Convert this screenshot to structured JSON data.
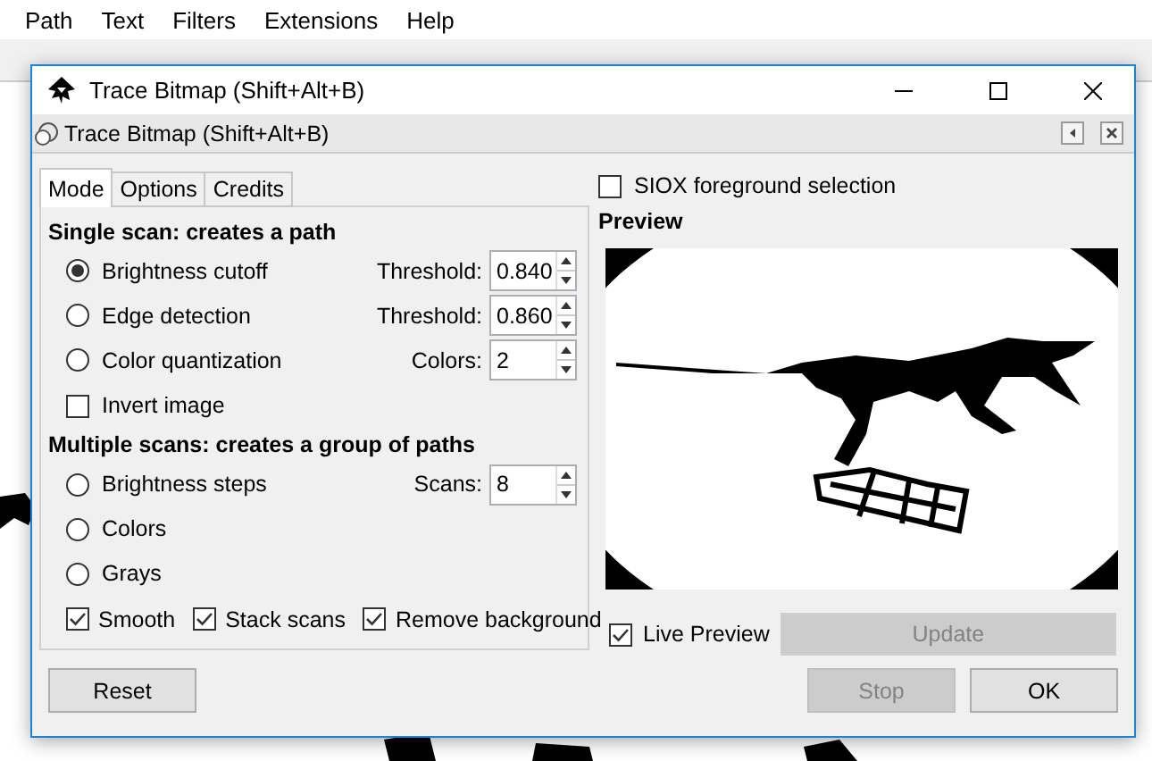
{
  "menu": [
    {
      "label": "Path"
    },
    {
      "label": "Text"
    },
    {
      "label": "Filters"
    },
    {
      "label": "Extensions"
    },
    {
      "label": "Help"
    }
  ],
  "dialog": {
    "title": "Trace Bitmap (Shift+Alt+B)",
    "panel_title": "Trace Bitmap (Shift+Alt+B)",
    "tabs": [
      {
        "label": "Mode",
        "selected": true
      },
      {
        "label": "Options",
        "selected": false
      },
      {
        "label": "Credits",
        "selected": false
      }
    ],
    "single_scan": {
      "heading": "Single scan: creates a path",
      "options": [
        {
          "label": "Brightness cutoff",
          "selected": true,
          "field_label": "Threshold:",
          "value": "0.840"
        },
        {
          "label": "Edge detection",
          "selected": false,
          "field_label": "Threshold:",
          "value": "0.860"
        },
        {
          "label": "Color quantization",
          "selected": false,
          "field_label": "Colors:",
          "value": "2"
        }
      ]
    },
    "invert_image": {
      "label": "Invert image",
      "checked": false
    },
    "multiple_scans": {
      "heading": "Multiple scans: creates a group of paths",
      "options": [
        {
          "label": "Brightness steps",
          "selected": false,
          "field_label": "Scans:",
          "value": "8"
        },
        {
          "label": "Colors",
          "selected": false
        },
        {
          "label": "Grays",
          "selected": false
        }
      ]
    },
    "multi_checks": [
      {
        "label": "Smooth",
        "checked": true
      },
      {
        "label": "Stack scans",
        "checked": true
      },
      {
        "label": "Remove background",
        "checked": true
      }
    ],
    "siox": {
      "label": "SIOX foreground selection",
      "checked": false
    },
    "preview": {
      "heading": "Preview"
    },
    "live_preview": {
      "label": "Live Preview",
      "checked": true
    },
    "update_button": {
      "label": "Update",
      "disabled": true
    },
    "reset_button": {
      "label": "Reset",
      "disabled": false
    },
    "buttons": [
      {
        "label": "Stop",
        "disabled": true
      },
      {
        "label": "OK",
        "disabled": false
      }
    ]
  }
}
